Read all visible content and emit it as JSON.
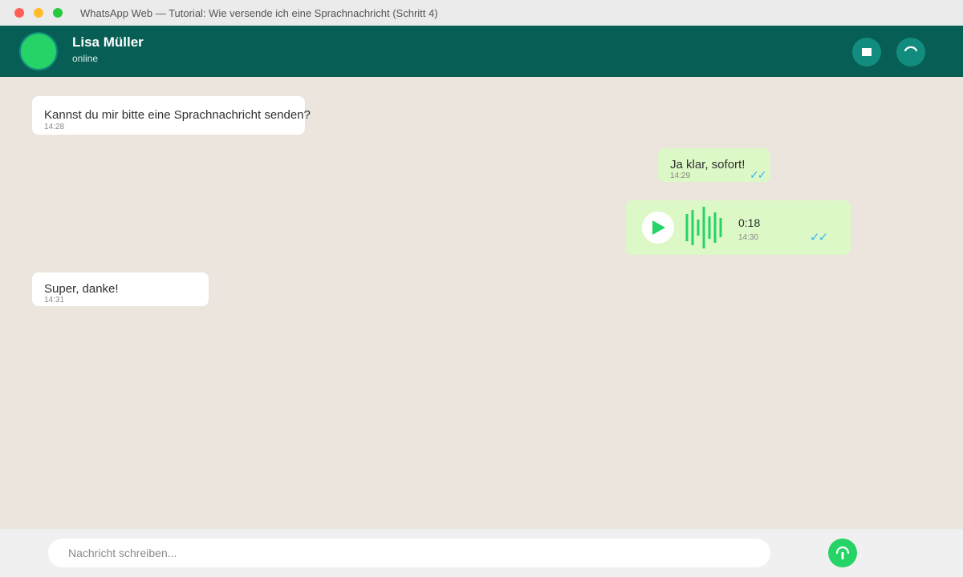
{
  "window": {
    "title": "WhatsApp Web — Tutorial: Wie versende ich eine Sprachnachricht (Schritt 4)"
  },
  "header": {
    "contact_name": "Lisa Müller",
    "contact_status": "online"
  },
  "messages": [
    {
      "direction": "incoming",
      "text": "Kannst du mir bitte eine Sprachnachricht senden?",
      "time": "14:28"
    },
    {
      "direction": "outgoing",
      "text": "Ja klar, sofort!",
      "time": "14:29",
      "ticks": "✓✓"
    },
    {
      "direction": "outgoing",
      "type": "voice",
      "duration": "0:18",
      "time": "14:30",
      "ticks": "✓✓"
    },
    {
      "direction": "incoming",
      "text": "Super, danke!",
      "time": "14:31"
    }
  ],
  "composer": {
    "placeholder": "Nachricht schreiben..."
  },
  "icons": {
    "video": "video-icon",
    "phone": "phone-icon",
    "play": "play-icon",
    "mic": "microphone-icon"
  },
  "colors": {
    "header": "#075e54",
    "accent": "#25d366",
    "outgoing_bubble": "#dcf8c6",
    "incoming_bubble": "#ffffff",
    "chat_background": "#ece5de",
    "read_ticks": "#34b7f1"
  }
}
